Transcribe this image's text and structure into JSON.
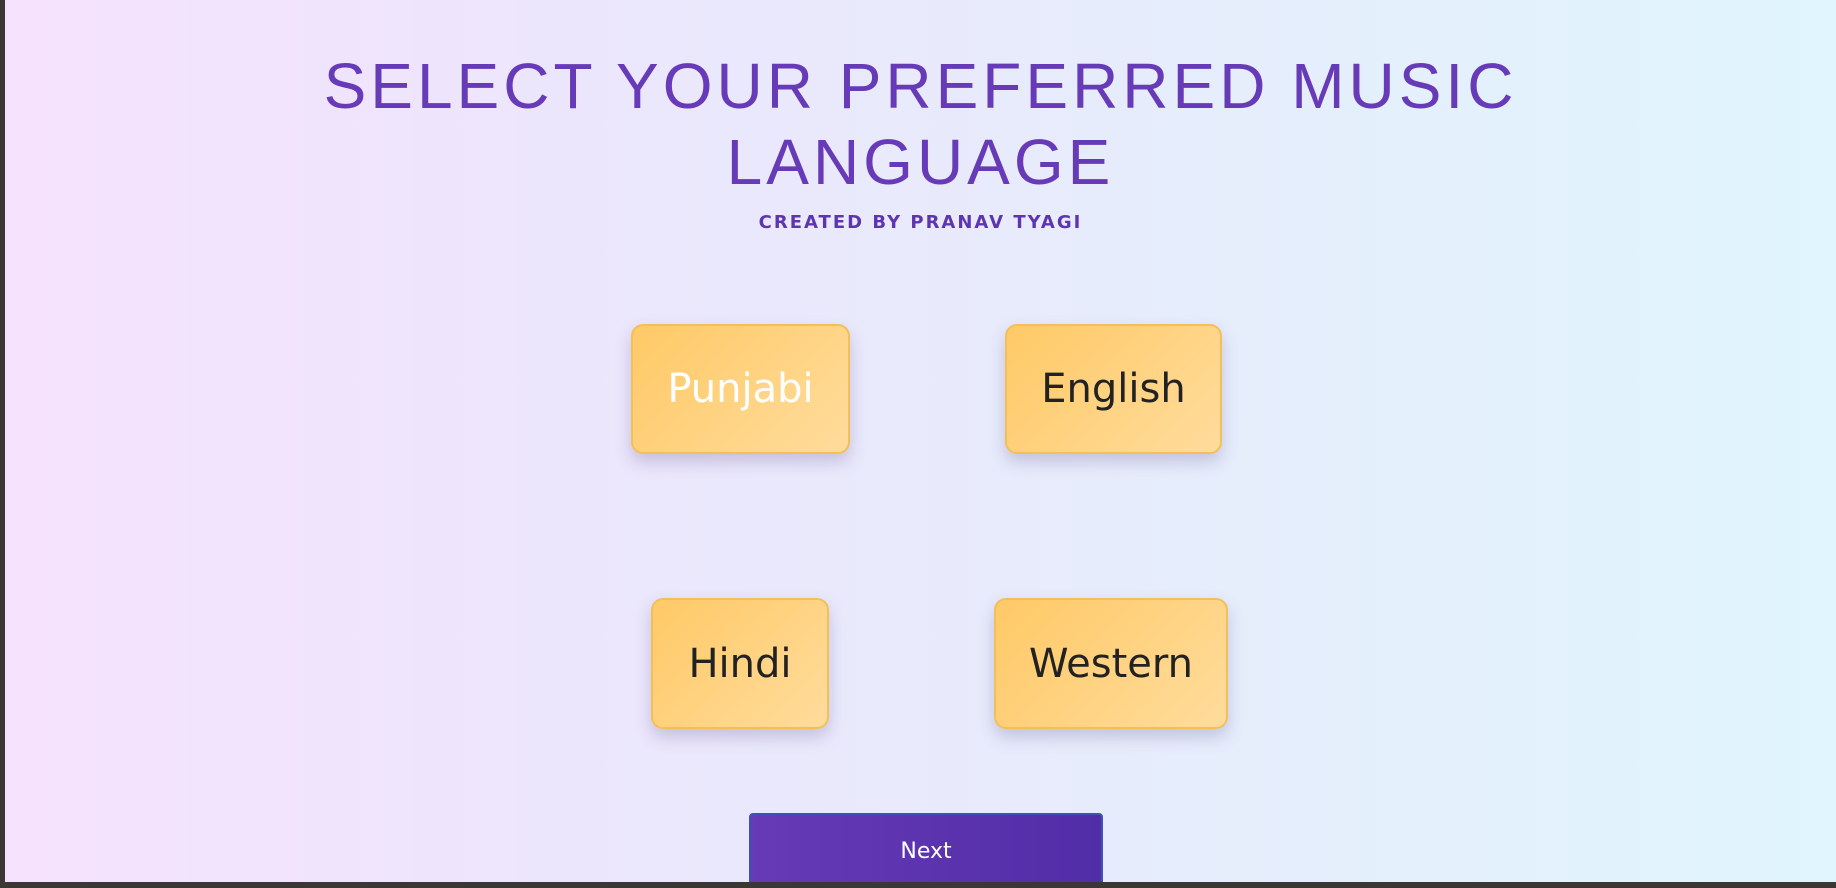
{
  "header": {
    "title_line1": "SELECT YOUR PREFERRED MUSIC",
    "title_line2": "LANGUAGE",
    "subtitle": "CREATED BY PRANAV TYAGI"
  },
  "languages": [
    {
      "label": "Punjabi",
      "selected": true
    },
    {
      "label": "English",
      "selected": false
    },
    {
      "label": "Hindi",
      "selected": false
    },
    {
      "label": "Western",
      "selected": false
    }
  ],
  "actions": {
    "next_label": "Next"
  },
  "colors": {
    "title": "#673ab7",
    "subtitle": "#5e35b1",
    "option_bg_start": "#ffc966",
    "option_bg_end": "#ffdc9c",
    "option_border": "#f3bf58",
    "next_bg": "#673ab7",
    "selected_text": "#ffffff"
  }
}
